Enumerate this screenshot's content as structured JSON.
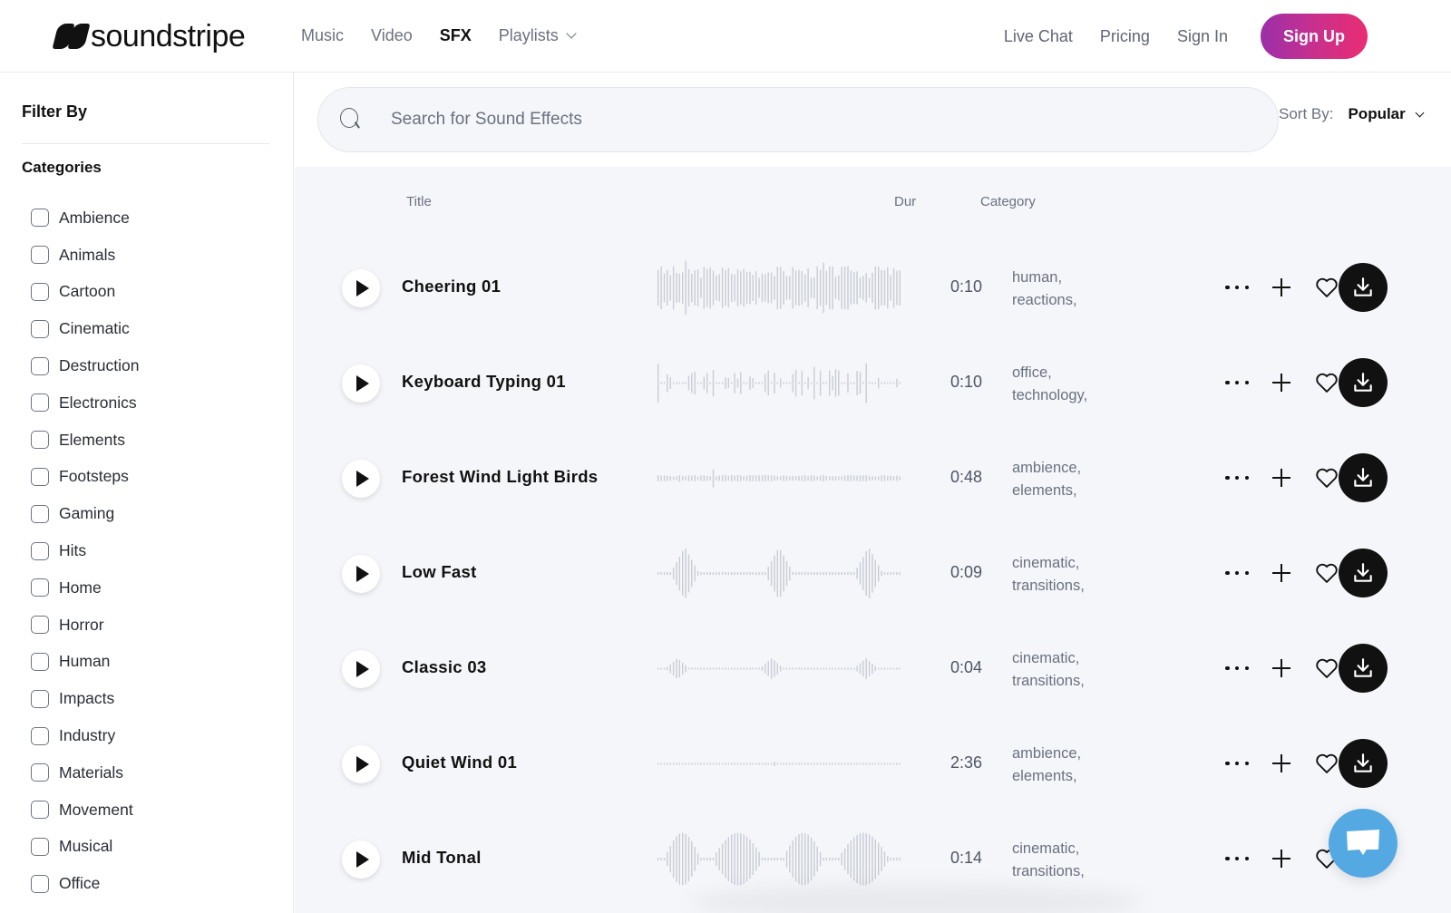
{
  "brand": {
    "name": "soundstripe"
  },
  "nav": {
    "links": [
      {
        "label": "Music",
        "active": false
      },
      {
        "label": "Video",
        "active": false
      },
      {
        "label": "SFX",
        "active": true
      },
      {
        "label": "Playlists",
        "active": false,
        "dropdown": true
      }
    ],
    "right": {
      "live_chat": "Live Chat",
      "pricing": "Pricing",
      "sign_in": "Sign In",
      "sign_up": "Sign Up"
    }
  },
  "sidebar": {
    "filter_title": "Filter By",
    "categories_title": "Categories",
    "categories": [
      {
        "label": "Ambience",
        "checked": false
      },
      {
        "label": "Animals",
        "checked": false
      },
      {
        "label": "Cartoon",
        "checked": false
      },
      {
        "label": "Cinematic",
        "checked": false
      },
      {
        "label": "Destruction",
        "checked": false
      },
      {
        "label": "Electronics",
        "checked": false
      },
      {
        "label": "Elements",
        "checked": false
      },
      {
        "label": "Footsteps",
        "checked": false
      },
      {
        "label": "Gaming",
        "checked": false
      },
      {
        "label": "Hits",
        "checked": false
      },
      {
        "label": "Home",
        "checked": false
      },
      {
        "label": "Horror",
        "checked": false
      },
      {
        "label": "Human",
        "checked": false
      },
      {
        "label": "Impacts",
        "checked": false
      },
      {
        "label": "Industry",
        "checked": false
      },
      {
        "label": "Materials",
        "checked": false
      },
      {
        "label": "Movement",
        "checked": false
      },
      {
        "label": "Musical",
        "checked": false
      },
      {
        "label": "Office",
        "checked": false
      }
    ]
  },
  "search": {
    "placeholder": "Search for Sound Effects",
    "value": ""
  },
  "sort": {
    "label": "Sort By:",
    "value": "Popular"
  },
  "table": {
    "headers": {
      "title": "Title",
      "duration": "Dur",
      "category": "Category"
    },
    "rows": [
      {
        "title": "Cheering 01",
        "duration": "0:10",
        "tags": [
          "human,",
          "reactions,"
        ],
        "waveform": "dense"
      },
      {
        "title": "Keyboard Typing 01",
        "duration": "0:10",
        "tags": [
          "office,",
          "technology,"
        ],
        "waveform": "clicks"
      },
      {
        "title": "Forest Wind Light Birds",
        "duration": "0:48",
        "tags": [
          "ambience,",
          "elements,"
        ],
        "waveform": "low"
      },
      {
        "title": "Low Fast",
        "duration": "0:09",
        "tags": [
          "cinematic,",
          "transitions,"
        ],
        "waveform": "bursts"
      },
      {
        "title": "Classic 03",
        "duration": "0:04",
        "tags": [
          "cinematic,",
          "transitions,"
        ],
        "waveform": "small-bursts"
      },
      {
        "title": "Quiet Wind 01",
        "duration": "2:36",
        "tags": [
          "ambience,",
          "elements,"
        ],
        "waveform": "flat"
      },
      {
        "title": "Mid Tonal",
        "duration": "0:14",
        "tags": [
          "cinematic,",
          "transitions,"
        ],
        "waveform": "swells"
      }
    ]
  },
  "icons": {
    "play": "play-icon",
    "more": "more-horizontal-icon",
    "add": "plus-icon",
    "favorite": "heart-icon",
    "download": "download-icon",
    "chat": "chat-bubble-icon",
    "search": "search-icon"
  },
  "colors": {
    "signup_gradient_start": "#9b2fa8",
    "signup_gradient_end": "#ea2d73",
    "chat_button": "#55a9e3",
    "download_button": "#111111",
    "main_background": "#f5f6fa"
  }
}
